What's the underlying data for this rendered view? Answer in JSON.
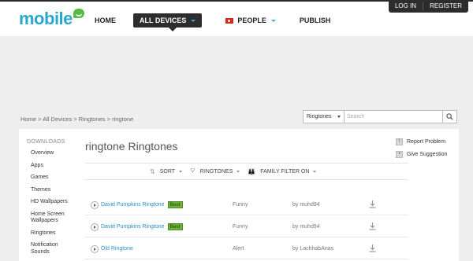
{
  "header": {
    "logo_text": "mobile",
    "top_links": [
      "LOG IN",
      "REGISTER"
    ],
    "nav": [
      {
        "label": "HOME"
      },
      {
        "label": "ALL DEVICES"
      },
      {
        "label": "PEOPLE"
      },
      {
        "label": "PUBLISH"
      }
    ]
  },
  "breadcrumb": "Home > All Devices > Ringtones > ringtone",
  "search": {
    "category": "Ringtones",
    "placeholder": "Search"
  },
  "sidebar": {
    "title": "DOWNLOADS",
    "items": [
      "Overview",
      "Apps",
      "Games",
      "Themes",
      "HD Wallpapers",
      "Home Screen Wallpapers",
      "Ringtones",
      "Notification Sounds"
    ]
  },
  "main": {
    "title": "ringtone Ringtones",
    "filters": {
      "sort": "SORT",
      "type": "RINGTONES",
      "family": "FAMILY FILTER ON"
    },
    "rows": [
      {
        "name": "David Pumpkins Ringtone",
        "badge": "Best",
        "category": "Funny",
        "author": "by muhd94"
      },
      {
        "name": "David Pumpkins Ringtone",
        "badge": "Best",
        "category": "Funny",
        "author": "by muhd94"
      },
      {
        "name": "Old Ringtone",
        "badge": "",
        "category": "Alert",
        "author": "by LachhabAnas"
      }
    ]
  },
  "right_actions": [
    "Report Problem",
    "Give Suggestion"
  ],
  "colors": {
    "brand": "#2aa7cf",
    "badge": "#6fb33a",
    "link": "#2a8fc7"
  }
}
